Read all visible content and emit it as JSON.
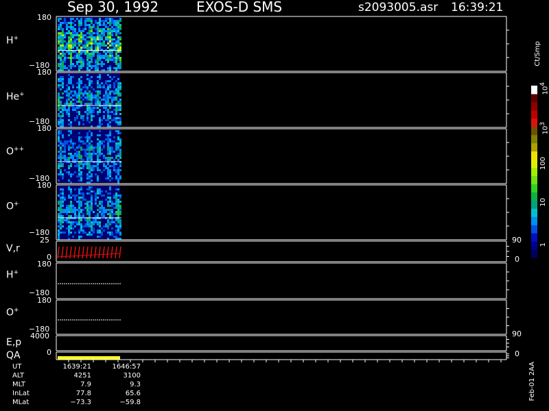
{
  "header": {
    "date": "Sep 30, 1992",
    "instrument": "EXOS-D SMS",
    "file": "s2093005.asr",
    "time": "16:39:21"
  },
  "panels": [
    {
      "label_base": "H",
      "label_sup": "+",
      "top": "180",
      "bottom": "−180"
    },
    {
      "label_base": "He",
      "label_sup": "+",
      "top": "180",
      "bottom": "−180"
    },
    {
      "label_base": "O",
      "label_sup": "++",
      "top": "180",
      "bottom": "−180"
    },
    {
      "label_base": "O",
      "label_sup": "+",
      "top": "180",
      "bottom": "−180"
    },
    {
      "label_base": "V,r",
      "label_sup": "",
      "top": "25",
      "bottom": "0",
      "right_top": "90",
      "right_bottom": "0"
    },
    {
      "label_base": "H",
      "label_sup": "+",
      "top": "180",
      "bottom": "−180"
    },
    {
      "label_base": "O",
      "label_sup": "+",
      "top": "180",
      "bottom": "−180"
    },
    {
      "label_base": "E,p",
      "label_sup": "",
      "top": "4000",
      "bottom": "",
      "right_top": "90",
      "right_bottom": ""
    },
    {
      "label_base": "QA",
      "label_sup": "",
      "top": "",
      "bottom": "0",
      "right_top": "",
      "right_bottom": "0"
    }
  ],
  "colorbar": {
    "unit": "Ct/Smp",
    "labels": [
      "1",
      "10",
      "100",
      "10",
      "10"
    ],
    "label_sups": [
      "",
      "",
      "",
      "3",
      "4"
    ],
    "colors": [
      "#000060",
      "#000090",
      "#0010c0",
      "#0050e0",
      "#0090f0",
      "#00c0d0",
      "#00a080",
      "#10b040",
      "#30d020",
      "#70e010",
      "#a0f000",
      "#e0f000",
      "#f0e000",
      "#b0a000",
      "#808000",
      "#705000",
      "#e01010",
      "#c00000",
      "#900000",
      "#600000",
      "#ffffff"
    ]
  },
  "footer": {
    "rows": [
      {
        "label": "UT",
        "v1": "1639:21",
        "v2": "1646:57"
      },
      {
        "label": "ALT",
        "v1": "4251",
        "v2": "3100"
      },
      {
        "label": "MLT",
        "v1": "7.9",
        "v2": "9.3"
      },
      {
        "label": "InLat",
        "v1": "77.8",
        "v2": "65.6"
      },
      {
        "label": "MLat",
        "v1": "−73.3",
        "v2": "−59.8"
      }
    ],
    "stamp": "Feb-01 2AA"
  },
  "chart_data": {
    "type": "heatmap",
    "title": "Sep 30, 1992   EXOS-D SMS",
    "data_time_range": [
      "1639:21",
      "1646:57"
    ],
    "panels": [
      {
        "name": "H+",
        "ylim": [
          -180,
          180
        ],
        "data": "pitch-angle spectrogram"
      },
      {
        "name": "He+",
        "ylim": [
          -180,
          180
        ],
        "data": "pitch-angle spectrogram"
      },
      {
        "name": "O++",
        "ylim": [
          -180,
          180
        ],
        "data": "pitch-angle spectrogram"
      },
      {
        "name": "O+",
        "ylim": [
          -180,
          180
        ],
        "data": "pitch-angle spectrogram"
      },
      {
        "name": "V,r",
        "ylim": [
          0,
          25
        ],
        "right_ylim": [
          0,
          90
        ]
      },
      {
        "name": "H+",
        "ylim": [
          -180,
          180
        ]
      },
      {
        "name": "O+",
        "ylim": [
          -180,
          180
        ]
      },
      {
        "name": "E,p",
        "ylim": [
          0,
          4000
        ],
        "right_ylim": [
          0,
          90
        ]
      },
      {
        "name": "QA",
        "ylim": [
          0,
          1
        ],
        "right_ylim": [
          0,
          1
        ]
      }
    ],
    "colorbar_scale": "log",
    "colorbar_range": [
      1,
      10000
    ]
  }
}
